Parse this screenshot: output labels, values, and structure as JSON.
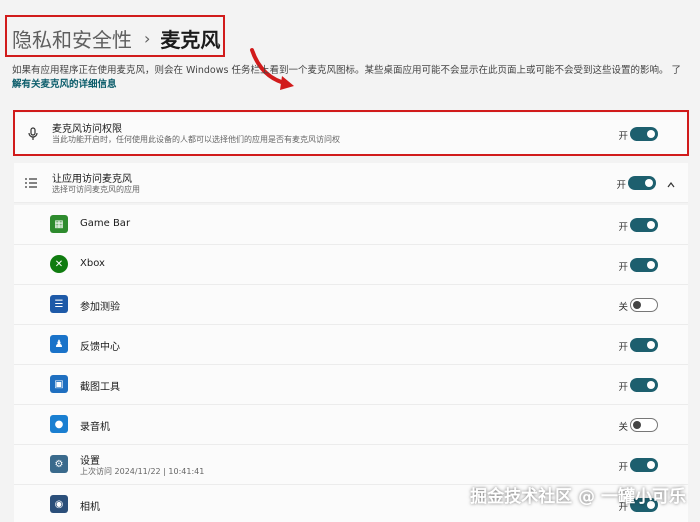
{
  "breadcrumb": {
    "parent": "隐私和安全性",
    "separator": "›",
    "current": "麦克风"
  },
  "description": "如果有应用程序正在使用麦克风，则会在 Windows 任务栏上看到一个麦克风图标。某些桌面应用可能不会显示在此页面上或可能不会受到这些设置的影响。 了",
  "learn_more_link": "解有关麦克风的详细信息",
  "mic_access": {
    "title": "麦克风访问权限",
    "subtitle": "当此功能开启时，任何使用此设备的人都可以选择他们的应用是否有麦克风访问权",
    "state": "开"
  },
  "app_access": {
    "title": "让应用访问麦克风",
    "subtitle": "选择可访问麦克风的应用",
    "state": "开",
    "expand_icon": "chevron-up-icon"
  },
  "apps": [
    {
      "name": "Game Bar",
      "state": "开",
      "icon": "game-bar-icon",
      "color": "#2e8b2e"
    },
    {
      "name": "Xbox",
      "state": "开",
      "icon": "xbox-icon",
      "color": "#107c10"
    },
    {
      "name": "参加测验",
      "state": "关",
      "icon": "take-a-test-icon",
      "color": "#1e5aa8"
    },
    {
      "name": "反馈中心",
      "state": "开",
      "icon": "feedback-hub-icon",
      "color": "#1a73c9"
    },
    {
      "name": "截图工具",
      "state": "开",
      "icon": "snipping-tool-icon",
      "color": "#1f6fc0"
    },
    {
      "name": "录音机",
      "state": "关",
      "icon": "sound-recorder-icon",
      "color": "#1a7fd1"
    },
    {
      "name": "设置",
      "state": "开",
      "icon": "settings-icon",
      "color": "#3a6a8c",
      "last_access": "上次访问 2024/11/22 | 10:41:41"
    },
    {
      "name": "相机",
      "state": "开",
      "icon": "camera-icon",
      "color": "#2b4f7a"
    }
  ],
  "watermark": "掘金技术社区 @ 一罐小可乐",
  "colors": {
    "toggle_on": "#1d5f6e",
    "highlight_box": "#d11b1b",
    "link": "#0a5c6a"
  }
}
